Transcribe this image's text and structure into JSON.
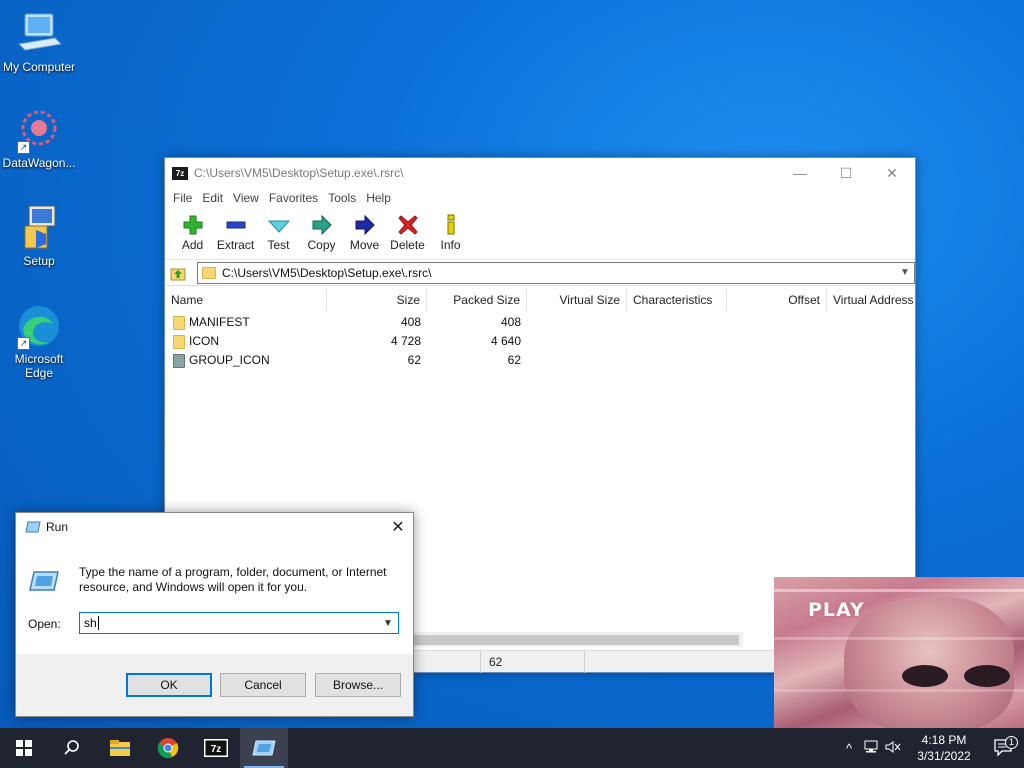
{
  "desktop": {
    "icons": [
      {
        "label": "My Computer"
      },
      {
        "label": "DataWagon..."
      },
      {
        "label": "Setup"
      },
      {
        "label": "Microsoft Edge"
      }
    ]
  },
  "sevenzip": {
    "title": "C:\\Users\\VM5\\Desktop\\Setup.exe\\.rsrc\\",
    "app_icon": "7z",
    "window_controls": {
      "minimize": "—",
      "maximize": "☐",
      "close": "✕"
    },
    "menu": [
      "File",
      "Edit",
      "View",
      "Favorites",
      "Tools",
      "Help"
    ],
    "toolbar": [
      {
        "label": "Add",
        "icon": "plus-icon"
      },
      {
        "label": "Extract",
        "icon": "minus-icon"
      },
      {
        "label": "Test",
        "icon": "check-icon"
      },
      {
        "label": "Copy",
        "icon": "double-arrow-icon"
      },
      {
        "label": "Move",
        "icon": "arrow-right-icon"
      },
      {
        "label": "Delete",
        "icon": "x-icon"
      },
      {
        "label": "Info",
        "icon": "info-icon"
      }
    ],
    "address": "C:\\Users\\VM5\\Desktop\\Setup.exe\\.rsrc\\",
    "columns": [
      "Name",
      "Size",
      "Packed Size",
      "Virtual Size",
      "Characteristics",
      "Offset",
      "Virtual Address"
    ],
    "rows": [
      {
        "name": "MANIFEST",
        "size": "408",
        "packed": "408",
        "kind": "folder"
      },
      {
        "name": "ICON",
        "size": "4 728",
        "packed": "4 640",
        "kind": "folder"
      },
      {
        "name": "GROUP_ICON",
        "size": "62",
        "packed": "62",
        "kind": "file"
      }
    ],
    "status": {
      "selected_size": "62"
    },
    "colors": {
      "folder": "#f7d774",
      "file": "#8aa3a3"
    }
  },
  "run_dialog": {
    "title": "Run",
    "description": "Type the name of a program, folder, document, or Internet resource, and Windows will open it for you.",
    "open_label": "Open:",
    "open_value": "sh",
    "buttons": {
      "ok": "OK",
      "cancel": "Cancel",
      "browse": "Browse..."
    }
  },
  "video_overlay": {
    "text": "PLAY"
  },
  "taskbar": {
    "apps": [
      "start-icon",
      "search-icon",
      "file-explorer-icon",
      "chrome-icon",
      "7zip-icon",
      "run-icon"
    ],
    "time": "4:18 PM",
    "date": "3/31/2022",
    "notification_count": "1"
  }
}
